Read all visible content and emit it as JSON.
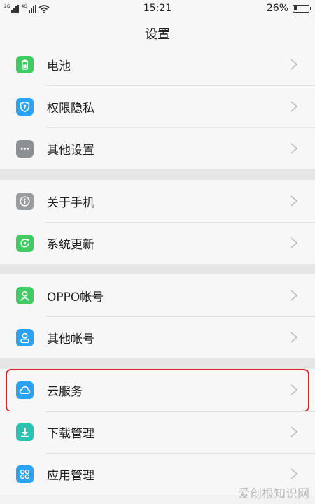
{
  "status_bar": {
    "sim1_tag": "2G",
    "sim2_tag": "4G",
    "time": "15:21",
    "battery": "26%",
    "battery_level": 0.26
  },
  "header": {
    "title": "设置"
  },
  "groups": [
    {
      "items": [
        {
          "label": "电池",
          "icon": "battery-icon",
          "color": "#3fcc62"
        },
        {
          "label": "权限隐私",
          "icon": "shield-icon",
          "color": "#2aa3f4"
        },
        {
          "label": "其他设置",
          "icon": "more-dots-icon",
          "color": "#8c8f94"
        }
      ]
    },
    {
      "items": [
        {
          "label": "关于手机",
          "icon": "info-icon",
          "color": "#9a9da2"
        },
        {
          "label": "系统更新",
          "icon": "update-icon",
          "color": "#3fcc62"
        }
      ]
    },
    {
      "items": [
        {
          "label": "OPPO帐号",
          "icon": "user-icon",
          "color": "#3fcc62"
        },
        {
          "label": "其他帐号",
          "icon": "user-icon",
          "color": "#2aa3f4"
        }
      ]
    },
    {
      "items": [
        {
          "label": "云服务",
          "icon": "cloud-icon",
          "color": "#2aa3f4"
        },
        {
          "label": "下载管理",
          "icon": "download-icon",
          "color": "#28c4b1"
        },
        {
          "label": "应用管理",
          "icon": "apps-icon",
          "color": "#2aa3f4"
        }
      ]
    }
  ],
  "highlight_color": "#d9252b",
  "watermark": "爱创根知识网"
}
